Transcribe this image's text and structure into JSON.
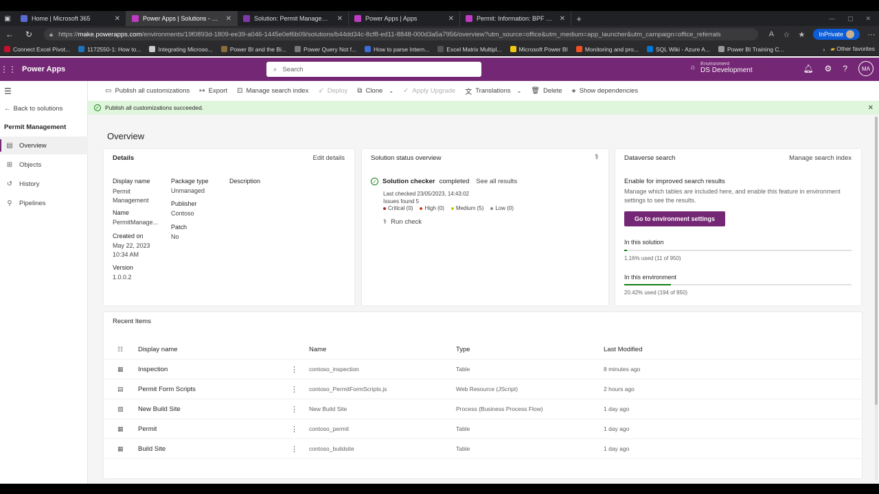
{
  "browser": {
    "tabs": [
      {
        "title": "Home | Microsoft 365",
        "color": "#5b6bd6"
      },
      {
        "title": "Power Apps | Solutions - Permit Management",
        "color": "#c03bc4"
      },
      {
        "title": "Solution: Permit Management - Power Apps",
        "color": "#7e3ba8"
      },
      {
        "title": "Power Apps | Apps",
        "color": "#c03bc4"
      },
      {
        "title": "Permit: Information: BPF Permit - Power Apps",
        "color": "#c03bc4"
      }
    ],
    "url_prefix": "https://",
    "url_host": "make.powerapps.com",
    "url_path": "/environments/19f0893d-1809-ee39-a046-1445e0ef6b09/solutions/b44dd34c-8cf8-ed11-8848-000d3a5a7956/overview?utm_source=office&utm_medium=app_launcher&utm_campaign=office_referrals",
    "inprivate_label": "InPrivate",
    "favorites": [
      {
        "label": "Connect Excel Pivot...",
        "color": "#c8102e"
      },
      {
        "label": "1172550-1: How to...",
        "color": "#1e73be"
      },
      {
        "label": "Integrating Microso...",
        "color": "#cccccc"
      },
      {
        "label": "Power BI and the Bi...",
        "color": "#8a6d3b"
      },
      {
        "label": "Power Query Not f...",
        "color": "#777777"
      },
      {
        "label": "How to parse Intern...",
        "color": "#3b6fd6"
      },
      {
        "label": "Excel Matrix Multipl...",
        "color": "#555555"
      },
      {
        "label": "Microsoft Power BI",
        "color": "#f2c811"
      },
      {
        "label": "Monitoring and pro...",
        "color": "#f25022"
      },
      {
        "label": "SQL Wiki - Azure A...",
        "color": "#0078d4"
      },
      {
        "label": "Power BI Training C...",
        "color": "#999999"
      }
    ],
    "other_favorites": "Other favorites"
  },
  "header": {
    "app_name": "Power Apps",
    "search_placeholder": "Search",
    "environment_label": "Environment",
    "environment_name": "DS Development",
    "user_initials": "MA"
  },
  "sidebar": {
    "back_label": "Back to solutions",
    "solution_title": "Permit Management",
    "items": [
      {
        "label": "Overview",
        "selected": true
      },
      {
        "label": "Objects",
        "selected": false
      },
      {
        "label": "History",
        "selected": false
      },
      {
        "label": "Pipelines",
        "selected": false
      }
    ]
  },
  "commands": {
    "publish": "Publish all customizations",
    "export": "Export",
    "manage_search": "Manage search index",
    "deploy": "Deploy",
    "clone": "Clone",
    "apply_upgrade": "Apply Upgrade",
    "translations": "Translations",
    "delete": "Delete",
    "show_dependencies": "Show dependencies"
  },
  "banner": {
    "message": "Publish all customizations succeeded."
  },
  "overview": {
    "title": "Overview",
    "details": {
      "heading": "Details",
      "edit_link": "Edit details",
      "display_name_label": "Display name",
      "display_name_value": "Permit Management",
      "name_label": "Name",
      "name_value": "PermitManage...",
      "created_on_label": "Created on",
      "created_on_date": "May 22, 2023",
      "created_on_time": "10:34 AM",
      "version_label": "Version",
      "version_value": "1.0.0.2",
      "package_type_label": "Package type",
      "package_type_value": "Unmanaged",
      "publisher_label": "Publisher",
      "publisher_value": "Contoso",
      "patch_label": "Patch",
      "patch_value": "No",
      "description_label": "Description"
    },
    "status": {
      "heading": "Solution status overview",
      "checker_label": "Solution checker",
      "checker_state": "completed",
      "see_all": "See all results",
      "last_checked": "Last checked 23/05/2023, 14:43:02",
      "issues_found": "Issues found 5",
      "critical": "Critical (0)",
      "high": "High (0)",
      "medium": "Medium (5)",
      "low": "Low (0)",
      "run_check": "Run check"
    },
    "dataverse": {
      "heading": "Dataverse search",
      "manage_link": "Manage search index",
      "enable_title": "Enable for improved search results",
      "enable_desc": "Manage which tables are included here, and enable this feature in environment settings to see the results.",
      "button": "Go to environment settings",
      "in_solution_label": "In this solution",
      "in_solution_usage": "1.16% used (11 of 950)",
      "in_solution_pct": 1.16,
      "in_env_label": "In this environment",
      "in_env_usage": "20.42% used (194 of 950)",
      "in_env_pct": 20.42
    },
    "recent": {
      "heading": "Recent Items",
      "columns": [
        "Display name",
        "Name",
        "Type",
        "Last Modified"
      ],
      "rows": [
        {
          "display": "Inspection",
          "name": "contoso_inspection",
          "type": "Table",
          "modified": "8 minutes ago"
        },
        {
          "display": "Permit Form Scripts",
          "name": "contoso_PermitFormScripts.js",
          "type": "Web Resource (JScript)",
          "modified": "2 hours ago"
        },
        {
          "display": "New Build Site",
          "name": "New Build Site",
          "type": "Process (Business Process Flow)",
          "modified": "1 day ago"
        },
        {
          "display": "Permit",
          "name": "contoso_permit",
          "type": "Table",
          "modified": "1 day ago"
        },
        {
          "display": "Build Site",
          "name": "contoso_buildsite",
          "type": "Table",
          "modified": "1 day ago"
        }
      ]
    }
  }
}
